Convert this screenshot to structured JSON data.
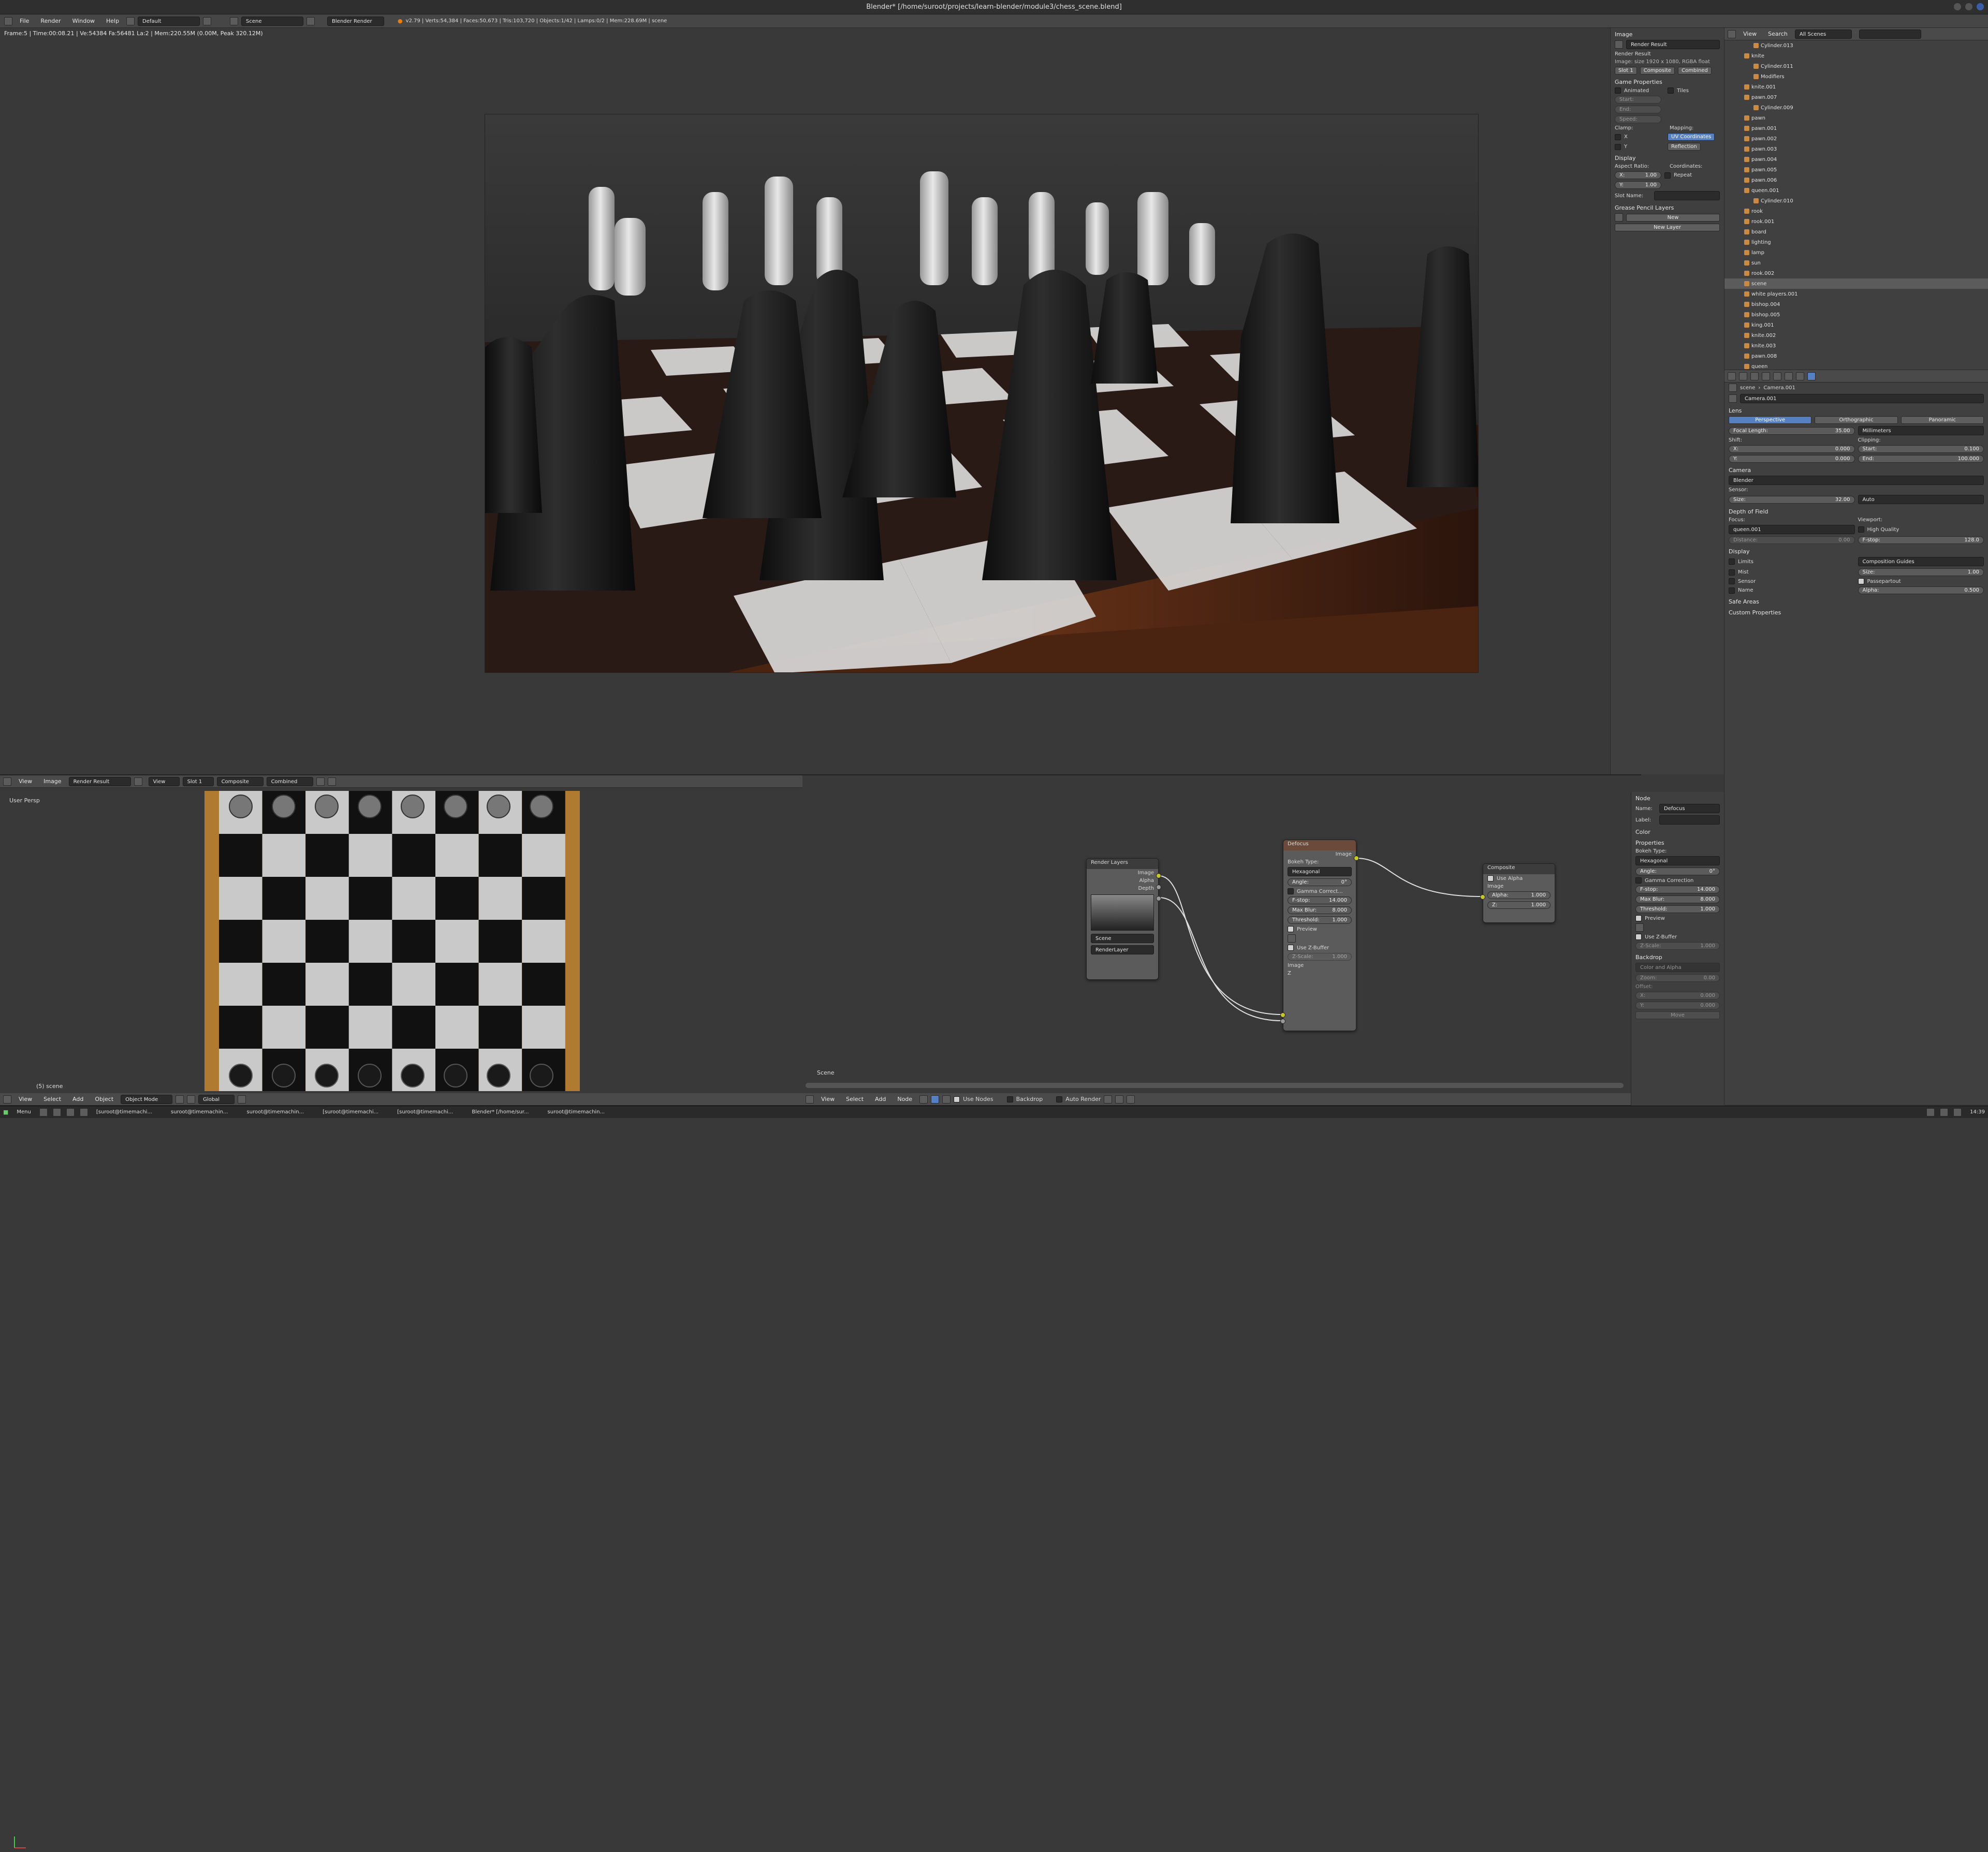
{
  "window": {
    "title": "Blender* [/home/suroot/projects/learn-blender/module3/chess_scene.blend]"
  },
  "menubar": {
    "menus": [
      "File",
      "Render",
      "Window",
      "Help"
    ],
    "layout": "Default",
    "scene": "Scene",
    "engine": "Blender Render",
    "stats": "v2.79 | Verts:54,384 | Faces:50,673 | Tris:103,720 | Objects:1/42 | Lamps:0/2 | Mem:228.69M | scene"
  },
  "viewport": {
    "info": "Frame:5 | Time:00:08.21 | Ve:54384 Fa:56481 La:2 | Mem:220.55M (0.00M, Peak 320.12M)"
  },
  "image_panel": {
    "title": "Image",
    "image_name": "Render Result",
    "render_result_label": "Render Result",
    "image_info": "Image: size 1920 x 1080, RGBA float",
    "slot": "Slot 1",
    "pass_layer": "Composite",
    "pass": "Combined",
    "game_properties": "Game Properties",
    "animated": "Animated",
    "tiles": "Tiles",
    "start": "Start:",
    "end": "End:",
    "speed": "Speed:",
    "clamp": "Clamp:",
    "mapping": "Mapping:",
    "clamp_x": "X",
    "clamp_y": "Y",
    "uv_coordinates": "UV Coordinates",
    "reflection": "Reflection",
    "display": "Display",
    "aspect_ratio": "Aspect Ratio:",
    "coordinates": "Coordinates:",
    "aspect_x": "X:",
    "aspect_x_val": "1.00",
    "aspect_y": "Y:",
    "aspect_y_val": "1.00",
    "repeat": "Repeat",
    "slot_name": "Slot Name:",
    "grease_pencil": "Grease Pencil Layers",
    "new": "New",
    "new_layer": "New Layer"
  },
  "outliner": {
    "view": "View",
    "search": "Search",
    "all_scenes": "All Scenes",
    "items": [
      "Cylinder.013",
      "knite",
      "Cylinder.011",
      "Modifiers",
      "knite.001",
      "pawn.007",
      "Cylinder.009",
      "pawn",
      "pawn.001",
      "pawn.002",
      "pawn.003",
      "pawn.004",
      "pawn.005",
      "pawn.006",
      "queen.001",
      "Cylinder.010",
      "rook",
      "rook.001",
      "board",
      "lighting",
      "lamp",
      "sun",
      "rook.002",
      "scene",
      "white players.001",
      "bishop.004",
      "bishop.005",
      "king.001",
      "knite.002",
      "knite.003",
      "pawn.008",
      "queen"
    ]
  },
  "properties": {
    "breadcrumb_scene": "scene",
    "breadcrumb_camera": "Camera.001",
    "camera_name": "Camera.001",
    "lens": "Lens",
    "perspective": "Perspective",
    "orthographic": "Orthographic",
    "panoramic": "Panoramic",
    "focal_length": "Focal Length:",
    "focal_length_val": "35.00",
    "units": "Millimeters",
    "shift": "Shift:",
    "clipping": "Clipping:",
    "shift_x": "X:",
    "shift_x_val": "0.000",
    "shift_y": "Y:",
    "shift_y_val": "0.000",
    "clip_start": "Start:",
    "clip_start_val": "0.100",
    "clip_end": "End:",
    "clip_end_val": "100.000",
    "camera": "Camera",
    "presets": "Blender",
    "sensor": "Sensor:",
    "sensor_size": "Size:",
    "sensor_size_val": "32.00",
    "sensor_fit": "Auto",
    "dof": "Depth of Field",
    "focus": "Focus:",
    "viewport": "Viewport:",
    "focus_obj": "queen.001",
    "high_quality": "High Quality",
    "distance": "Distance:",
    "distance_val": "0.00",
    "fstop": "F-stop:",
    "fstop_val": "128.0",
    "display": "Display",
    "limits": "Limits",
    "mist": "Mist",
    "sensor_cb": "Sensor",
    "name": "Name",
    "guides": "Composition Guides",
    "disp_size": "Size:",
    "disp_size_val": "1.00",
    "passepartout": "Passepartout",
    "alpha": "Alpha:",
    "alpha_val": "0.500",
    "safe_areas": "Safe Areas",
    "custom_props": "Custom Properties"
  },
  "uv_editor": {
    "menus": [
      "View",
      "Image"
    ],
    "image": "Render Result",
    "view": "View",
    "slot": "Slot 1",
    "layer": "Composite",
    "pass": "Combined",
    "overlay": "User Persp",
    "footer": "(5) scene",
    "footer_menus": [
      "View",
      "Select",
      "Add",
      "Object"
    ],
    "mode": "Object Mode",
    "pivot": "Global"
  },
  "node_editor": {
    "scene_label": "Scene",
    "footer_menus": [
      "View",
      "Select",
      "Add",
      "Node"
    ],
    "use_nodes": "Use Nodes",
    "backdrop": "Backdrop",
    "auto_render": "Auto Render",
    "render_layers": {
      "title": "Render Layers",
      "out_image": "Image",
      "out_alpha": "Alpha",
      "out_depth": "Depth",
      "scene": "Scene",
      "layer": "RenderLayer"
    },
    "defocus": {
      "title": "Defocus",
      "out_image": "Image",
      "bokeh_type": "Bokeh Type:",
      "bokeh": "Hexagonal",
      "angle": "Angle:",
      "angle_val": "0°",
      "gamma": "Gamma Correct...",
      "fstop": "F-stop:",
      "fstop_val": "14.000",
      "maxblur": "Max Blur:",
      "maxblur_val": "8.000",
      "threshold": "Threshold:",
      "threshold_val": "1.000",
      "preview": "Preview",
      "zbuffer": "Use Z-Buffer",
      "zscale": "Z-Scale:",
      "zscale_val": "1.000",
      "in_image": "Image",
      "in_z": "Z"
    },
    "composite": {
      "title": "Composite",
      "use_alpha": "Use Alpha",
      "in_image": "Image",
      "alpha": "Alpha:",
      "alpha_val": "1.000",
      "z": "Z:",
      "z_val": "1.000"
    }
  },
  "node_props": {
    "node": "Node",
    "name": "Name:",
    "name_val": "Defocus",
    "label": "Label:",
    "color": "Color",
    "properties": "Properties",
    "bokeh_type": "Bokeh Type:",
    "bokeh": "Hexagonal",
    "angle": "Angle:",
    "angle_val": "0°",
    "gamma": "Gamma Correction",
    "fstop": "F-stop:",
    "fstop_val": "14.000",
    "maxblur": "Max Blur:",
    "maxblur_val": "8.000",
    "threshold": "Threshold:",
    "threshold_val": "1.000",
    "preview": "Preview",
    "zbuffer": "Use Z-Buffer",
    "zscale": "Z-Scale:",
    "zscale_val": "1.000",
    "backdrop": "Backdrop",
    "backdrop_mode": "Color and Alpha",
    "zoom": "Zoom:",
    "zoom_val": "0.00",
    "offset": "Offset:",
    "offset_x": "X:",
    "offset_x_val": "0.000",
    "offset_y": "Y:",
    "offset_y_val": "0.000",
    "move": "Move"
  },
  "taskbar": {
    "menu": "Menu",
    "tasks": [
      "[suroot@timemachi...",
      "suroot@timemachin...",
      "suroot@timemachin...",
      "[suroot@timemachi...",
      "[suroot@timemachi...",
      "Blender* [/home/sur...",
      "suroot@timemachin..."
    ],
    "clock": "14:39"
  },
  "colors": {
    "selection": "#5680c2",
    "socket": "#c7c729",
    "object_icon": "#c88a44"
  }
}
